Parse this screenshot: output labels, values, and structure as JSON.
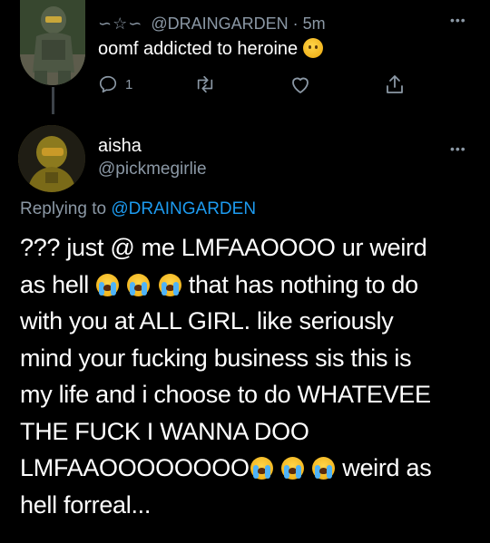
{
  "parent_tweet": {
    "decoration": "∽☆∽",
    "handle": "@DRAINGARDEN",
    "separator": "·",
    "time": "5m",
    "text": "oomf addicted to heroine",
    "emoji": "worried-face",
    "reply_count": "1",
    "icons": [
      "reply-icon",
      "retweet-icon",
      "like-icon",
      "share-icon"
    ]
  },
  "reply_tweet": {
    "display_name": "aisha",
    "handle": "@pickmegirlie",
    "replying_prefix": "Replying to",
    "replying_to": "@DRAINGARDEN",
    "lines": [
      "??? just @ me LMFAAOOOO ur weird",
      "as hell",
      "that has nothing to do",
      "with you at ALL GIRL. like seriously",
      "mind your fucking business sis this is",
      "my life and i choose to do WHATEVEE",
      "THE FUCK I WANNA DOO",
      "LMFAAOOOOOOOO",
      "weird as",
      "hell forreal..."
    ],
    "emoji": "loudly-crying-face"
  },
  "colors": {
    "background": "#000000",
    "text_primary": "#ffffff",
    "text_secondary": "#8b98a5",
    "link": "#1d9bf0"
  }
}
